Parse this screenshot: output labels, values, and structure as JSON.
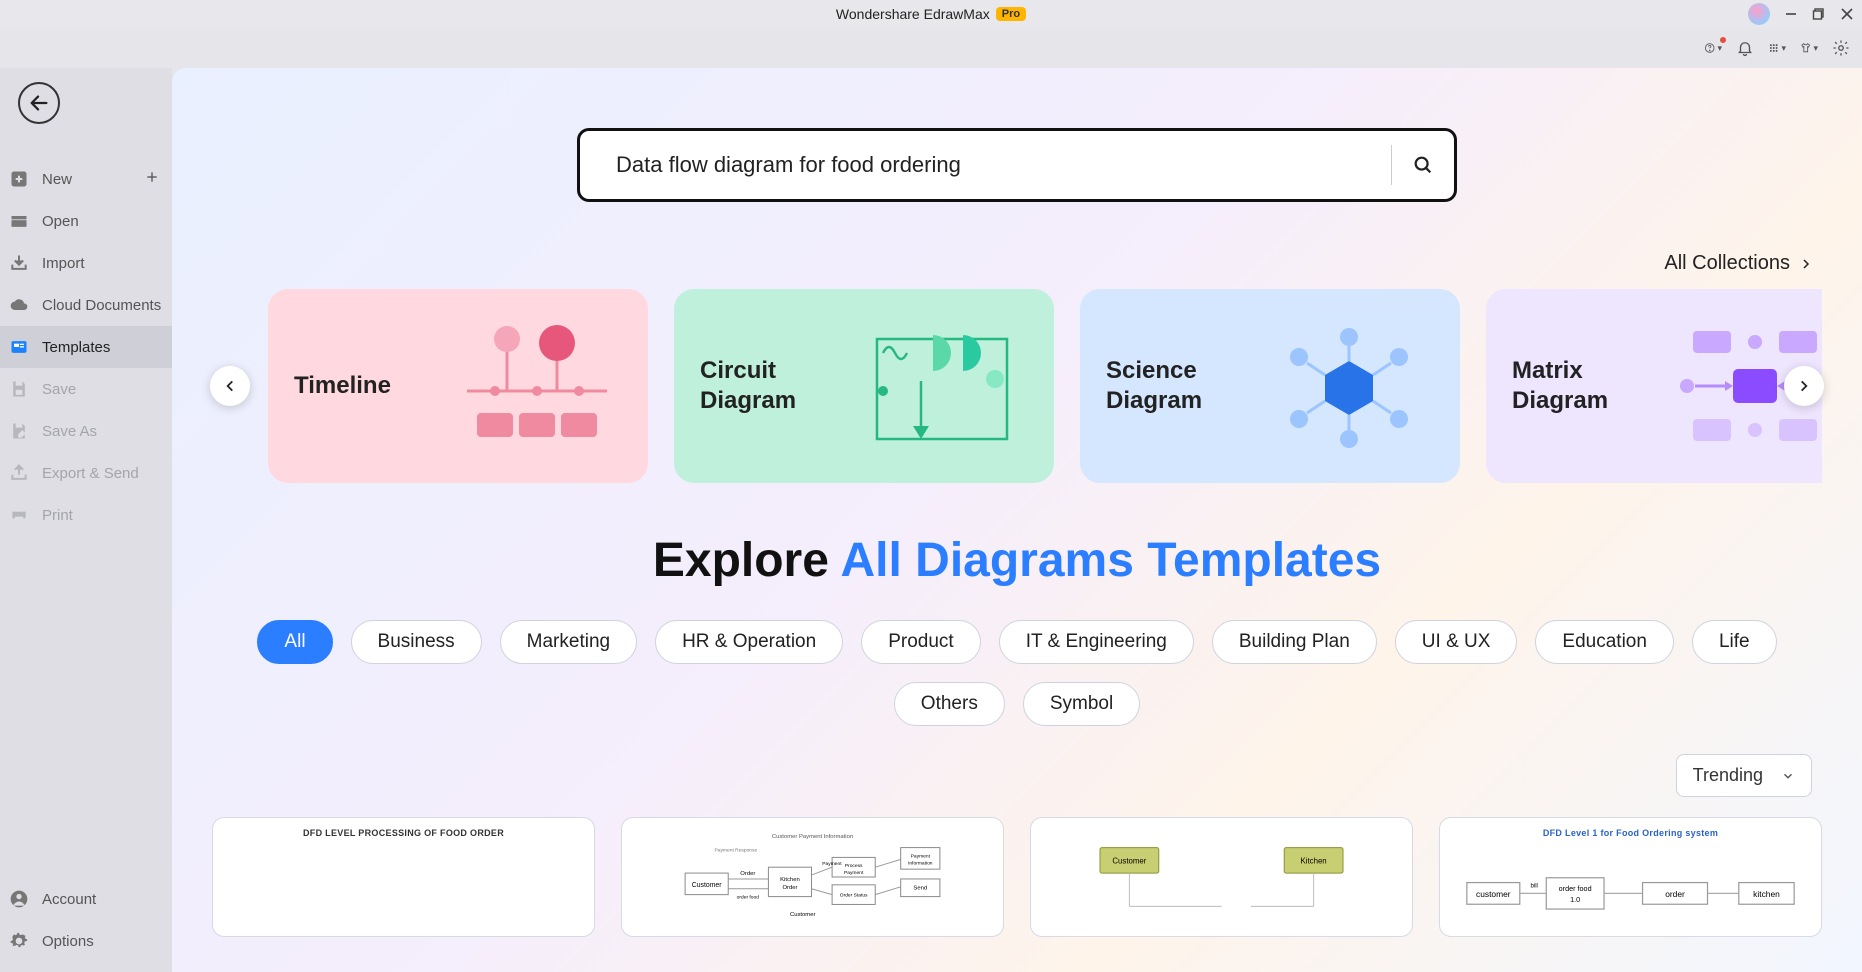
{
  "app": {
    "title": "Wondershare EdrawMax",
    "badge": "Pro"
  },
  "sidebar": {
    "items": [
      {
        "label": "New"
      },
      {
        "label": "Open"
      },
      {
        "label": "Import"
      },
      {
        "label": "Cloud Documents"
      },
      {
        "label": "Templates"
      },
      {
        "label": "Save"
      },
      {
        "label": "Save As"
      },
      {
        "label": "Export & Send"
      },
      {
        "label": "Print"
      }
    ],
    "bottom": [
      {
        "label": "Account"
      },
      {
        "label": "Options"
      }
    ]
  },
  "search": {
    "value": "Data flow diagram for food ordering"
  },
  "all_collections_label": "All Collections",
  "carousel": [
    {
      "label": "Timeline"
    },
    {
      "label": "Circuit Diagram"
    },
    {
      "label": "Science Diagram"
    },
    {
      "label": "Matrix Diagram"
    }
  ],
  "explore": {
    "prefix": "Explore ",
    "highlight": "All Diagrams Templates"
  },
  "chips": [
    "All",
    "Business",
    "Marketing",
    "HR & Operation",
    "Product",
    "IT & Engineering",
    "Building Plan",
    "UI & UX",
    "Education",
    "Life",
    "Others",
    "Symbol"
  ],
  "trending_label": "Trending",
  "templates": [
    {
      "title": "DFD LEVEL PROCESSING OF FOOD ORDER"
    },
    {
      "title": ""
    },
    {
      "title": ""
    },
    {
      "title": "DFD Level 1 for Food Ordering system"
    }
  ]
}
